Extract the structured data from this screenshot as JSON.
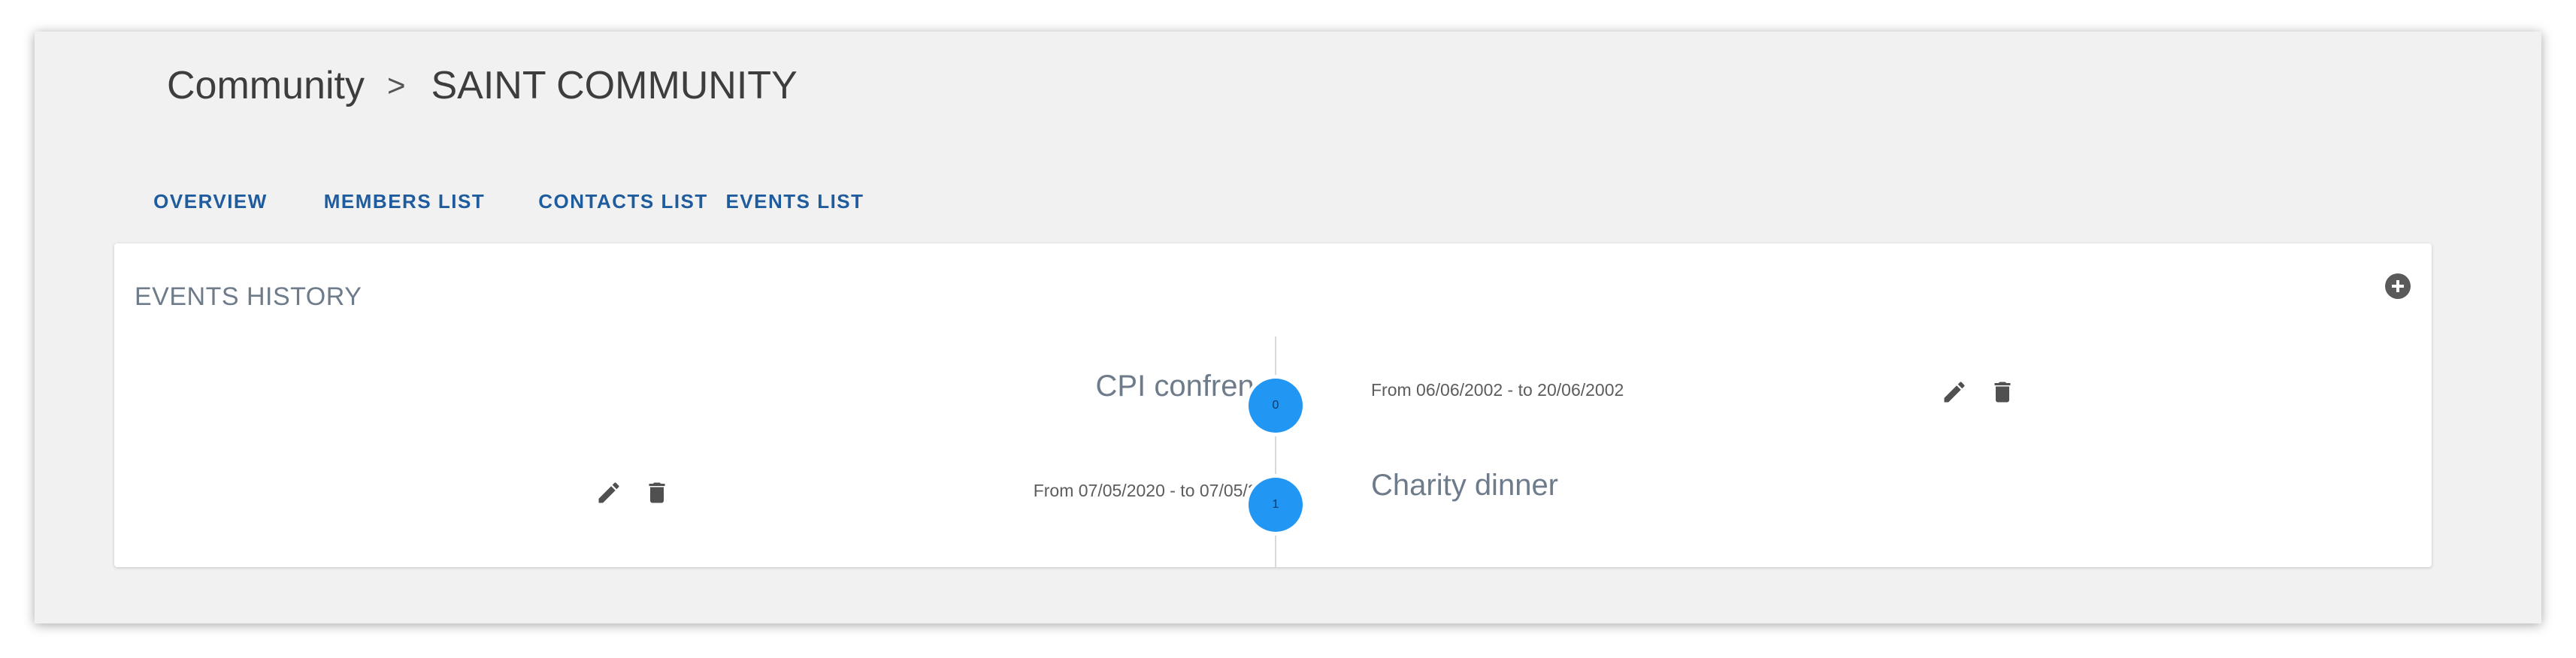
{
  "breadcrumb": {
    "root": "Community",
    "separator": ">",
    "current": "SAINT COMMUNITY"
  },
  "tabs": [
    {
      "label": "OVERVIEW",
      "active": false
    },
    {
      "label": "MEMBERS LIST",
      "active": false
    },
    {
      "label": "CONTACTS LIST",
      "active": false
    },
    {
      "label": "EVENTS LIST",
      "active": true
    }
  ],
  "events_history": {
    "title": "EVENTS HISTORY",
    "add_icon": "add-circle-icon",
    "events": [
      {
        "index": "0",
        "title": "CPI confrence",
        "date_range": "From 06/06/2002 - to 20/06/2002"
      },
      {
        "index": "1",
        "title": "Charity dinner",
        "date_range": "From 07/05/2020 - to 07/05/2020"
      }
    ]
  },
  "colors": {
    "accent": "#1f5c9e",
    "dot": "#2196f3",
    "background": "#f1f1f1",
    "card": "#ffffff",
    "muted_text": "#6e7b8a"
  },
  "icons": {
    "edit": "pencil-icon",
    "delete": "trash-icon"
  }
}
